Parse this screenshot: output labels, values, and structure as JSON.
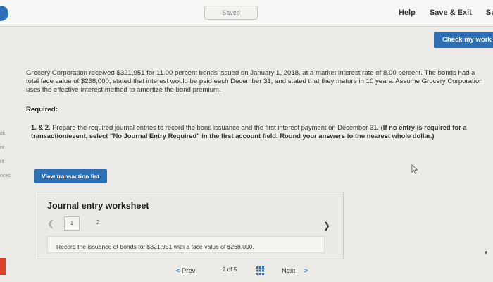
{
  "header": {
    "saved_label": "Saved",
    "links": [
      "Help",
      "Save & Exit",
      "Subm"
    ],
    "check_button": "Check my work"
  },
  "rail": {
    "labels": [
      "ok",
      "nt",
      "nt",
      "nces"
    ]
  },
  "question": {
    "text": "Grocery Corporation received $321,951 for 11.00 percent bonds issued on January 1, 2018, at a market interest rate of 8.00 percent. The bonds had a total face value of $268,000, stated that interest would be paid each December 31, and stated that they mature in 10 years. Assume Grocery Corporation uses the effective-interest method to amortize the bond premium.",
    "required_label": "Required:",
    "instruction_number": "1. & 2.",
    "instruction_plain": "Prepare the required journal entries to record the bond issuance and the first interest payment on December 31.",
    "instruction_bold": "(If no entry is required for a transaction/event, select \"No Journal Entry Required\" in the first account field. Round your answers to the nearest whole dollar.)"
  },
  "view_button": "View transaction list",
  "worksheet": {
    "title": "Journal entry worksheet",
    "tabs": [
      "1",
      "2"
    ],
    "description": "Record the issuance of bonds for $321,951 with a face value of $268,000."
  },
  "footer": {
    "prev": "Prev",
    "page_count": "2 of 5",
    "next": "Next"
  },
  "icons": {
    "prev": "chevron-left-icon",
    "next": "chevron-right-icon",
    "grid": "grid-icon"
  },
  "colors": {
    "accent": "#2d6fb5",
    "background": "#ecebe8",
    "alert": "#d9442a"
  }
}
